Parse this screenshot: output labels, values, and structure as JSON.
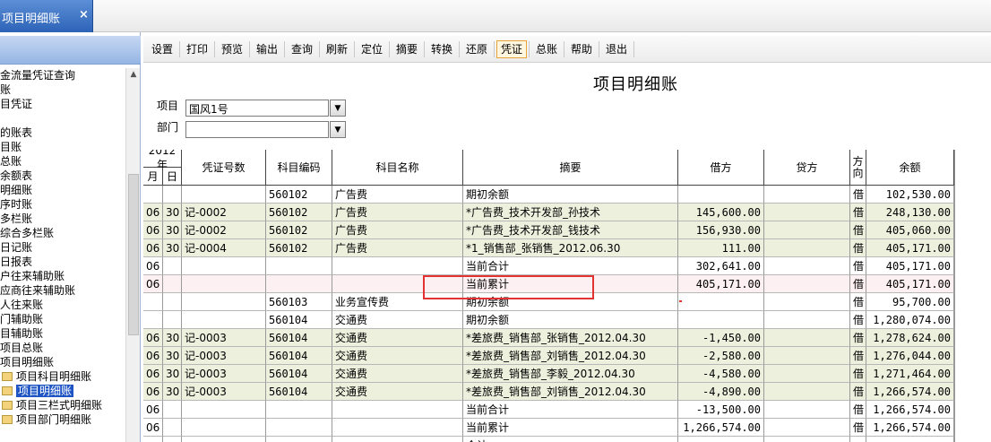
{
  "tab": {
    "label": "项目明细账",
    "close_icon": "×"
  },
  "tree": {
    "items": [
      {
        "label": "金流量凭证查询",
        "folder": false,
        "selected": false
      },
      {
        "label": "账",
        "folder": false,
        "selected": false
      },
      {
        "label": "目凭证",
        "folder": false,
        "selected": false
      },
      {
        "label": "",
        "folder": false,
        "selected": false
      },
      {
        "label": "的账表",
        "folder": false,
        "selected": false
      },
      {
        "label": "目账",
        "folder": false,
        "selected": false
      },
      {
        "label": "总账",
        "folder": false,
        "selected": false
      },
      {
        "label": "余额表",
        "folder": false,
        "selected": false
      },
      {
        "label": "明细账",
        "folder": false,
        "selected": false
      },
      {
        "label": "序时账",
        "folder": false,
        "selected": false
      },
      {
        "label": "多栏账",
        "folder": false,
        "selected": false
      },
      {
        "label": "综合多栏账",
        "folder": false,
        "selected": false
      },
      {
        "label": "日记账",
        "folder": false,
        "selected": false
      },
      {
        "label": "日报表",
        "folder": false,
        "selected": false
      },
      {
        "label": "户往来辅助账",
        "folder": false,
        "selected": false
      },
      {
        "label": "应商往来辅助账",
        "folder": false,
        "selected": false
      },
      {
        "label": "人往来账",
        "folder": false,
        "selected": false
      },
      {
        "label": "门辅助账",
        "folder": false,
        "selected": false
      },
      {
        "label": "目辅助账",
        "folder": false,
        "selected": false
      },
      {
        "label": "项目总账",
        "folder": false,
        "selected": false
      },
      {
        "label": "项目明细账",
        "folder": false,
        "selected": false
      },
      {
        "label": "项目科目明细账",
        "folder": true,
        "selected": false
      },
      {
        "label": "项目明细账",
        "folder": true,
        "selected": true
      },
      {
        "label": "项目三栏式明细账",
        "folder": true,
        "selected": false
      },
      {
        "label": "项目部门明细账",
        "folder": true,
        "selected": false
      }
    ]
  },
  "toolbar": {
    "buttons": [
      "设置",
      "打印",
      "预览",
      "输出",
      "查询",
      "刷新",
      "定位",
      "摘要",
      "转换",
      "还原",
      "凭证",
      "总账",
      "帮助",
      "退出"
    ],
    "active": "凭证"
  },
  "report": {
    "title": "项目明细账"
  },
  "filters": {
    "project_label": "项目",
    "project_value": "国风1号",
    "dept_label": "部门",
    "dept_value": ""
  },
  "grid": {
    "headers": {
      "year": "2012年",
      "month": "月",
      "day": "日",
      "voucher": "凭证号数",
      "subject_code": "科目编码",
      "subject_name": "科目名称",
      "summary": "摘要",
      "debit": "借方",
      "credit": "贷方",
      "direction": "方向",
      "balance": "余额"
    },
    "rows": [
      {
        "style": "white",
        "m": "",
        "d": "",
        "voucher": "",
        "code": "560102",
        "name": "广告费",
        "summary": "期初余额",
        "debit": "",
        "credit": "",
        "dir": "借",
        "balance": "102,530.00"
      },
      {
        "style": "beige",
        "m": "06",
        "d": "30",
        "voucher": "记-0002",
        "code": "560102",
        "name": "广告费",
        "summary": "*广告费_技术开发部_孙技术",
        "debit": "145,600.00",
        "credit": "",
        "dir": "借",
        "balance": "248,130.00"
      },
      {
        "style": "beige",
        "m": "06",
        "d": "30",
        "voucher": "记-0002",
        "code": "560102",
        "name": "广告费",
        "summary": "*广告费_技术开发部_钱技术",
        "debit": "156,930.00",
        "credit": "",
        "dir": "借",
        "balance": "405,060.00"
      },
      {
        "style": "beige",
        "m": "06",
        "d": "30",
        "voucher": "记-0004",
        "code": "560102",
        "name": "广告费",
        "summary": "*1_销售部_张销售_2012.06.30",
        "debit": "111.00",
        "credit": "",
        "dir": "借",
        "balance": "405,171.00"
      },
      {
        "style": "white",
        "m": "06",
        "d": "",
        "voucher": "",
        "code": "",
        "name": "",
        "summary": "当前合计",
        "debit": "302,641.00",
        "credit": "",
        "dir": "借",
        "balance": "405,171.00"
      },
      {
        "style": "pink",
        "m": "06",
        "d": "",
        "voucher": "",
        "code": "",
        "name": "",
        "summary": "当前累计",
        "debit": "405,171.00",
        "credit": "",
        "dir": "借",
        "balance": "405,171.00"
      },
      {
        "style": "white",
        "m": "",
        "d": "",
        "voucher": "",
        "code": "560103",
        "name": "业务宣传费",
        "summary": "期初余额",
        "debit": "",
        "credit": "",
        "dir": "借",
        "balance": "95,700.00"
      },
      {
        "style": "white",
        "m": "",
        "d": "",
        "voucher": "",
        "code": "560104",
        "name": "交通费",
        "summary": "期初余额",
        "debit": "",
        "credit": "",
        "dir": "借",
        "balance": "1,280,074.00"
      },
      {
        "style": "beige",
        "m": "06",
        "d": "30",
        "voucher": "记-0003",
        "code": "560104",
        "name": "交通费",
        "summary": "*差旅费_销售部_张销售_2012.04.30",
        "debit": "-1,450.00",
        "credit": "",
        "dir": "借",
        "balance": "1,278,624.00"
      },
      {
        "style": "beige",
        "m": "06",
        "d": "30",
        "voucher": "记-0003",
        "code": "560104",
        "name": "交通费",
        "summary": "*差旅费_销售部_刘销售_2012.04.30",
        "debit": "-2,580.00",
        "credit": "",
        "dir": "借",
        "balance": "1,276,044.00"
      },
      {
        "style": "beige",
        "m": "06",
        "d": "30",
        "voucher": "记-0003",
        "code": "560104",
        "name": "交通费",
        "summary": "*差旅费_销售部_李毅_2012.04.30",
        "debit": "-4,580.00",
        "credit": "",
        "dir": "借",
        "balance": "1,271,464.00"
      },
      {
        "style": "beige",
        "m": "06",
        "d": "30",
        "voucher": "记-0003",
        "code": "560104",
        "name": "交通费",
        "summary": "*差旅费_销售部_刘销售_2012.04.30",
        "debit": "-4,890.00",
        "credit": "",
        "dir": "借",
        "balance": "1,266,574.00"
      },
      {
        "style": "white",
        "m": "06",
        "d": "",
        "voucher": "",
        "code": "",
        "name": "",
        "summary": "当前合计",
        "debit": "-13,500.00",
        "credit": "",
        "dir": "借",
        "balance": "1,266,574.00"
      },
      {
        "style": "white",
        "m": "06",
        "d": "",
        "voucher": "",
        "code": "",
        "name": "",
        "summary": "当前累计",
        "debit": "1,266,574.00",
        "credit": "",
        "dir": "借",
        "balance": "1,266,574.00"
      },
      {
        "style": "white",
        "m": "",
        "d": "",
        "voucher": "",
        "code": "",
        "name": "",
        "summary": "合计",
        "debit": "",
        "credit": "",
        "dir": "",
        "balance": ""
      }
    ]
  }
}
